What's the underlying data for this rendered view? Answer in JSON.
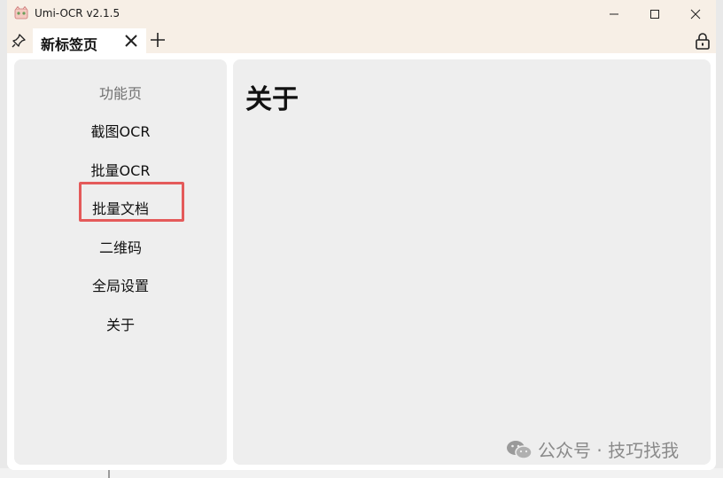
{
  "window": {
    "title": "Umi-OCR v2.1.5",
    "app_icon": "umi-ocr-app-icon",
    "controls": [
      "minimize-icon",
      "maximize-icon",
      "close-icon"
    ]
  },
  "tabbar": {
    "pin_icon": "pin-icon",
    "active_tab_label": "新标签页",
    "tab_close_icon": "close-icon",
    "add_tab_icon": "plus-icon",
    "lock_icon": "lock-icon"
  },
  "sidebar": {
    "title": "功能页",
    "items": [
      {
        "label": "截图OCR"
      },
      {
        "label": "批量OCR"
      },
      {
        "label": "批量文档"
      },
      {
        "label": "二维码"
      },
      {
        "label": "全局设置"
      },
      {
        "label": "关于"
      }
    ],
    "highlighted_index": 2,
    "highlight_color": "#e45a5a"
  },
  "main": {
    "title": "关于"
  },
  "watermark": {
    "icon": "wechat-icon",
    "text": "公众号 · 技巧找我"
  }
}
